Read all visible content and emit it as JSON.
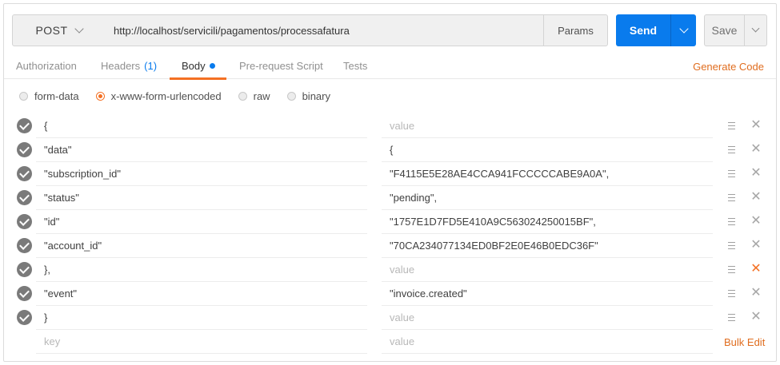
{
  "request": {
    "method": "POST",
    "url": "http://localhost/servicili/pagamentos/processafatura",
    "params_label": "Params",
    "send_label": "Send",
    "save_label": "Save"
  },
  "tabs": [
    {
      "label": "Authorization"
    },
    {
      "label": "Headers",
      "count": "(1)"
    },
    {
      "label": "Body",
      "active": true
    },
    {
      "label": "Pre-request Script"
    },
    {
      "label": "Tests"
    }
  ],
  "generate_code_label": "Generate Code",
  "body_modes": [
    {
      "label": "form-data",
      "selected": false
    },
    {
      "label": "x-www-form-urlencoded",
      "selected": true
    },
    {
      "label": "raw",
      "selected": false
    },
    {
      "label": "binary",
      "selected": false
    }
  ],
  "rows": [
    {
      "key": "{",
      "value": "",
      "placeholder": "value"
    },
    {
      "key": "\"data\"",
      "value": "{",
      "placeholder": "value"
    },
    {
      "key": "\"subscription_id\"",
      "value": "\"F4115E5E28AE4CCA941FCCCCCABE9A0A\",",
      "placeholder": "value"
    },
    {
      "key": "\"status\"",
      "value": "\"pending\",",
      "placeholder": "value"
    },
    {
      "key": "\"id\"",
      "value": "\"1757E1D7FD5E410A9C563024250015BF\",",
      "placeholder": "value"
    },
    {
      "key": "\"account_id\"",
      "value": "\"70CA234077134ED0BF2E0E46B0EDC36F\"",
      "placeholder": "value"
    },
    {
      "key": "},",
      "value": "",
      "placeholder": "value",
      "delete_hover": true
    },
    {
      "key": "\"event\"",
      "value": "\"invoice.created\"",
      "placeholder": "value"
    },
    {
      "key": "}",
      "value": "",
      "placeholder": "value"
    }
  ],
  "new_row": {
    "key_placeholder": "key",
    "value_placeholder": "value"
  },
  "bulk_edit_label": "Bulk Edit",
  "colors": {
    "accent": "#f47023",
    "send": "#097bed"
  },
  "icons": [
    "chevron-down-icon",
    "check-circle-icon",
    "drag-handle-icon",
    "close-icon"
  ]
}
